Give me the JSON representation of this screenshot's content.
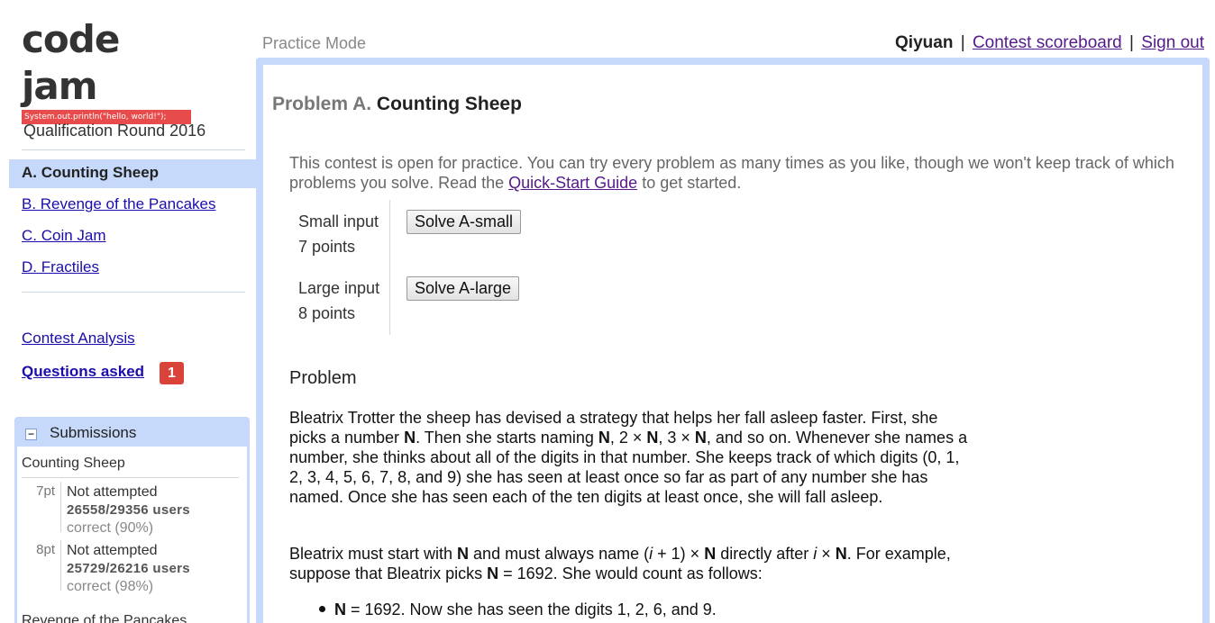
{
  "logo": {
    "title": "code jam",
    "tagline": "System.out.println(\"hello, world!\");"
  },
  "sidebar": {
    "round_title": "Qualification Round 2016",
    "problems": [
      {
        "label": "A. Counting Sheep",
        "active": true
      },
      {
        "label": "B. Revenge of the Pancakes",
        "active": false
      },
      {
        "label": "C. Coin Jam",
        "active": false
      },
      {
        "label": "D. Fractiles",
        "active": false
      }
    ],
    "analysis_label": "Contest Analysis",
    "questions_label": "Questions asked",
    "questions_count": "1",
    "submissions": {
      "toggle": "−",
      "title": "Submissions",
      "problem": "Counting Sheep",
      "rows": [
        {
          "points": "7pt",
          "status": "Not attempted",
          "users": "26558/29356 users",
          "correct": "correct (90%)"
        },
        {
          "points": "8pt",
          "status": "Not attempted",
          "users": "25729/26216 users",
          "correct": "correct (98%)"
        }
      ],
      "next_problem": "Revenge of the Pancakes"
    }
  },
  "topbar": {
    "mode": "Practice Mode",
    "username": "Qiyuan",
    "scoreboard_label": "Contest scoreboard",
    "signout_label": "Sign out",
    "separator": "|"
  },
  "main": {
    "problem_letter": "Problem A.",
    "problem_name": "Counting Sheep",
    "practice_note_before": "This contest is open for practice. You can try every problem as many times as you like, though we won't keep track of which problems you solve. Read the ",
    "practice_link": "Quick-Start Guide",
    "practice_note_after": " to get started.",
    "inputs": [
      {
        "label": "Small input",
        "points": "7 points",
        "button": "Solve A-small"
      },
      {
        "label": "Large input",
        "points": "8 points",
        "button": "Solve A-large"
      }
    ],
    "section_title": "Problem",
    "paragraph1": "Bleatrix Trotter the sheep has devised a strategy that helps her fall asleep faster. First, she picks a number N. Then she starts naming N, 2 × N, 3 × N, and so on. Whenever she names a number, she thinks about all of the digits in that number. She keeps track of which digits (0, 1, 2, 3, 4, 5, 6, 7, 8, and 9) she has seen at least once so far as part of any number she has named. Once she has seen each of the ten digits at least once, she will fall asleep.",
    "paragraph2": "Bleatrix must start with N and must always name (i + 1) × N directly after i × N. For example, suppose that Bleatrix picks N = 1692. She would count as follows:",
    "bullet1": "N = 1692. Now she has seen the digits 1, 2, 6, and 9."
  },
  "colors": {
    "panel_border": "#c6d9fb",
    "active_item": "#c6d9fb",
    "badge": "#d9433a",
    "link": "#1a0dab",
    "visited_link": "#551a8b"
  }
}
